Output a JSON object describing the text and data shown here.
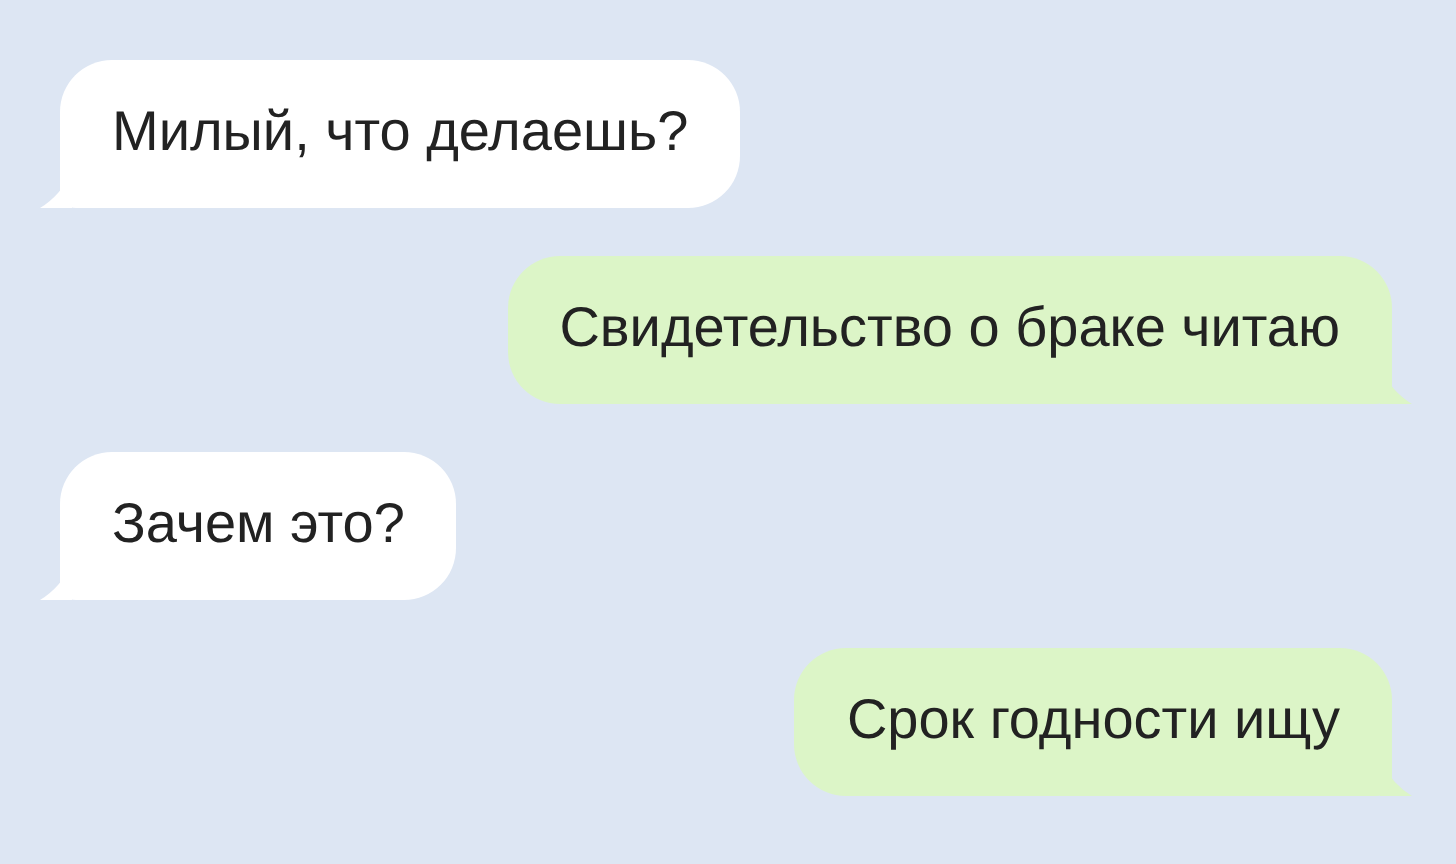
{
  "messages": [
    {
      "kind": "incoming",
      "text": "Милый, что делаешь?"
    },
    {
      "kind": "outgoing",
      "text": "Свидетельство о браке читаю"
    },
    {
      "kind": "incoming",
      "text": "Зачем это?"
    },
    {
      "kind": "outgoing",
      "text": "Срок годности ищу"
    }
  ]
}
